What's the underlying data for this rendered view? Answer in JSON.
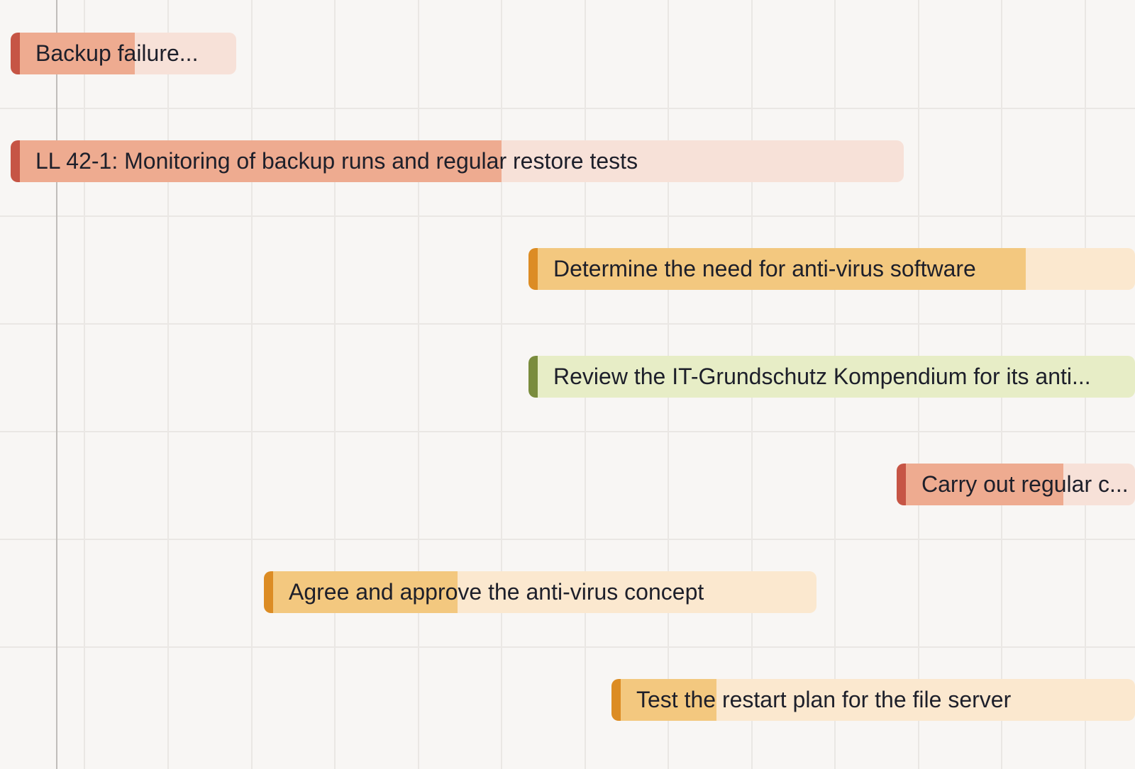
{
  "gantt": {
    "tasks": [
      {
        "label": "Backup failure...",
        "status": "red",
        "progress": 0.55
      },
      {
        "label": "LL 42-1: Monitoring of backup runs and regular restore tests",
        "status": "red",
        "progress": 0.55
      },
      {
        "label": "Determine the need for anti-virus software",
        "status": "orange",
        "progress": 0.82
      },
      {
        "label": "Review the IT-Grundschutz Kompendium for its anti...",
        "status": "green",
        "progress": 0
      },
      {
        "label": "Carry out regular c...",
        "status": "red",
        "progress": 0.7
      },
      {
        "label": "Agree and approve the anti-virus concept",
        "status": "orange",
        "progress": 0.35
      },
      {
        "label": "Test the restart plan for the file server",
        "status": "orange",
        "progress": 0.2
      }
    ],
    "colors": {
      "red": "#c65545",
      "orange": "#dc8c24",
      "green": "#7a8c3d",
      "background": "#f8f6f4",
      "grid": "#eae7e4"
    }
  }
}
